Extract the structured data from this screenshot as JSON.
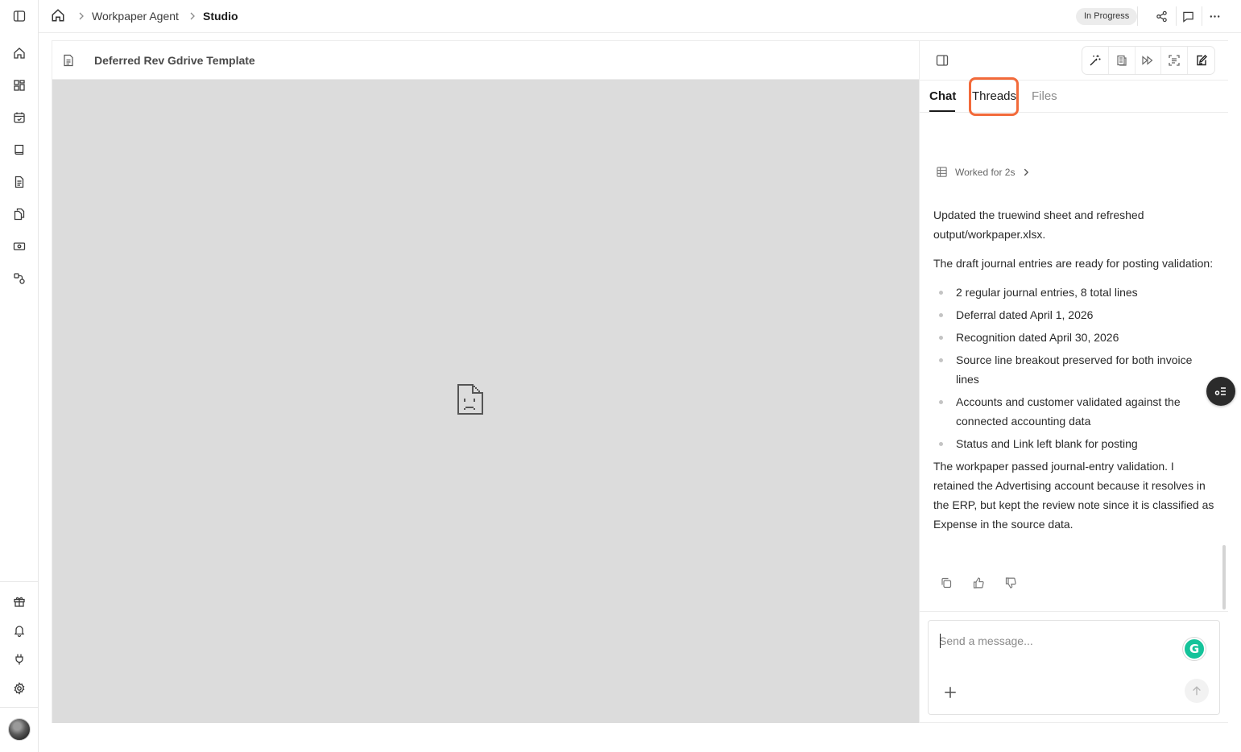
{
  "breadcrumb": {
    "parent": "Workpaper Agent",
    "current": "Studio"
  },
  "status": "In Progress",
  "document": {
    "title": "Deferred Rev Gdrive Template"
  },
  "panel": {
    "tabs": [
      {
        "label": "Chat",
        "active": true
      },
      {
        "label": "Threads",
        "active": false
      },
      {
        "label": "Files",
        "active": false
      }
    ],
    "worked_label": "Worked for 2s",
    "message": {
      "para1": "Updated the truewind sheet and refreshed output/workpaper.xlsx.",
      "para2": "The draft journal entries are ready for posting validation:",
      "bullets": [
        "2 regular journal entries, 8 total lines",
        "Deferral dated April 1, 2026",
        "Recognition dated April 30, 2026",
        "Source line breakout preserved for both invoice lines",
        "Accounts and customer validated against the connected accounting data",
        "Status and Link left blank for posting"
      ],
      "para3": "The workpaper passed journal-entry validation. I retained the Advertising account because it resolves in the ERP, but kept the review note since it is classified as Expense in the source data."
    },
    "composer": {
      "placeholder": "Send a message...",
      "assistant_badge": "G"
    }
  },
  "colors": {
    "highlight": "#f26a3a",
    "preview_bg": "#dcdcdc",
    "grammarly": "#15c39a"
  }
}
